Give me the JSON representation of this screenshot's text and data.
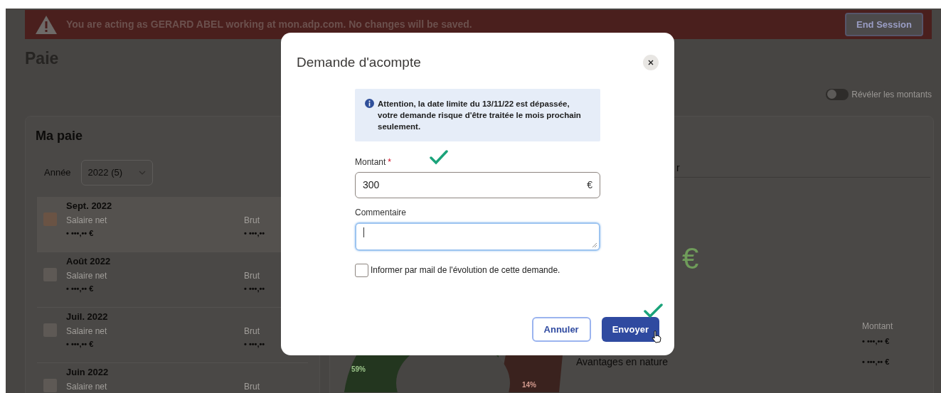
{
  "banner": {
    "message": "You are acting as GERARD ABEL working at mon.adp.com. No changes will be saved.",
    "button": "End Session"
  },
  "page_title": "Paie",
  "reveal_toggle": {
    "label": "Révéler les montants",
    "on": false
  },
  "pay_card": {
    "title": "Ma paie",
    "year_label": "Année",
    "year_value": "2022 (5)",
    "rows": [
      {
        "month": "Sept. 2022",
        "net_label": "Salaire net",
        "net_value": "• •••,•• €",
        "gross_label": "Brut",
        "gross_value": "• •••,••",
        "selected": true
      },
      {
        "month": "Août 2022",
        "net_label": "Salaire net",
        "net_value": "• •••,•• €",
        "gross_label": "Brut",
        "gross_value": "• •••,••",
        "selected": false
      },
      {
        "month": "Juil. 2022",
        "net_label": "Salaire net",
        "net_value": "• •••,•• €",
        "gross_label": "Brut",
        "gross_value": "• •••,••",
        "selected": false
      },
      {
        "month": "Juin 2022",
        "net_label": "Salaire net",
        "gross_label": "Brut",
        "selected": false
      }
    ]
  },
  "detail_card": {
    "tab_fragment": "r",
    "amount_currency": "€",
    "chart_labels": [
      "59%",
      "14%"
    ],
    "column_header": "Montant",
    "rows": [
      {
        "value": "• •••,•• €"
      },
      {
        "label": "Avantages en nature",
        "value": "• •••,•• €"
      }
    ]
  },
  "modal": {
    "title": "Demande d'acompte",
    "alert": "Attention, la date limite du 13/11/22 est dépassée, votre demande risque d'être traitée le mois prochain seulement.",
    "amount": {
      "label": "Montant",
      "required_mark": "*",
      "value": "300",
      "suffix": "€"
    },
    "comment": {
      "label": "Commentaire",
      "focused": true
    },
    "notify": {
      "label": "Informer par mail de l'évolution de cette demande.",
      "checked": false
    },
    "buttons": [
      {
        "label": "Annuler",
        "kind": "secondary"
      },
      {
        "label": "Envoyer",
        "kind": "primary"
      }
    ]
  }
}
